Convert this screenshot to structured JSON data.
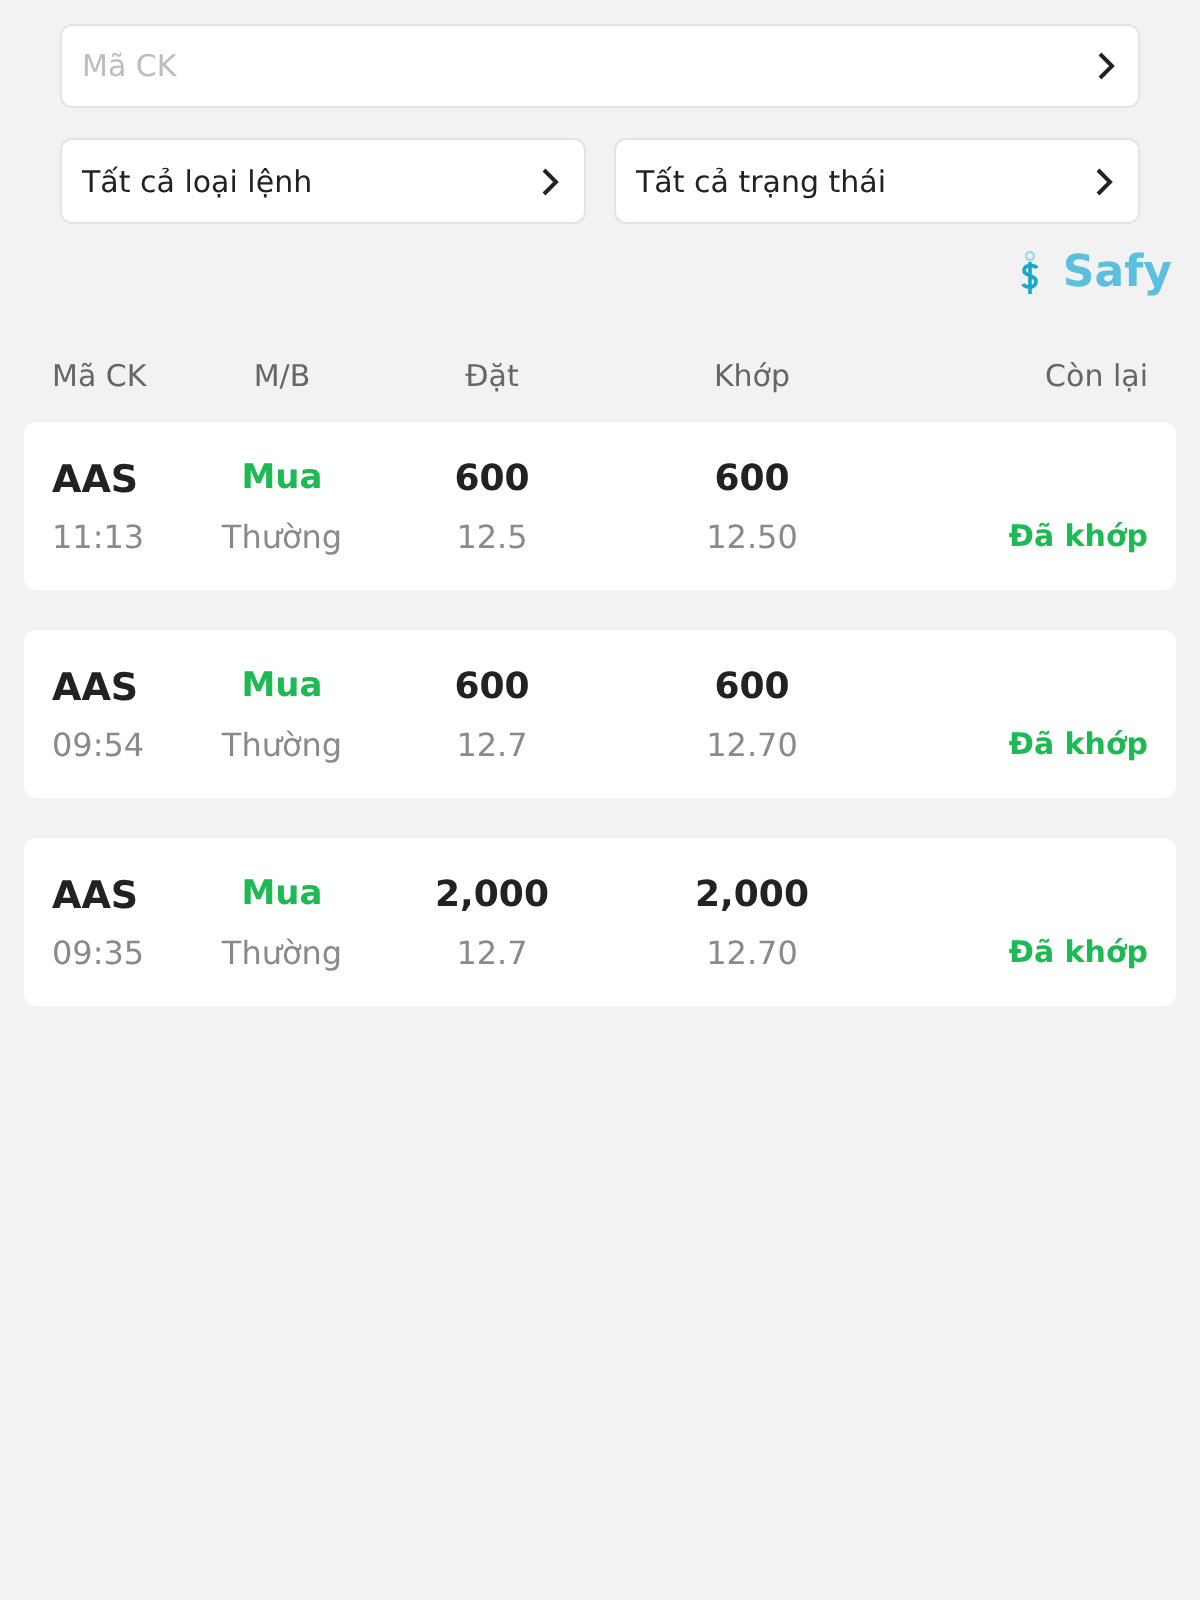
{
  "search": {
    "placeholder": "Mã CK"
  },
  "filters": [
    {
      "label": "Tất cả loại lệnh"
    },
    {
      "label": "Tất cả trạng thái"
    }
  ],
  "brand": {
    "name": "Safy"
  },
  "table": {
    "columns": [
      "Mã CK",
      "M/B",
      "Đặt",
      "Khớp",
      "Còn lại"
    ],
    "rows": [
      {
        "symbol": "AAS",
        "time": "11:13",
        "side": {
          "text": "Mua",
          "kind": "buy"
        },
        "order_type": "Thường",
        "order_qty": "600",
        "order_price": "12.5",
        "match_qty": "600",
        "match_price": "12.50",
        "status": {
          "text": "Đã khớp",
          "kind": "matched"
        }
      },
      {
        "symbol": "AAS",
        "time": "09:54",
        "side": {
          "text": "Mua",
          "kind": "buy"
        },
        "order_type": "Thường",
        "order_qty": "600",
        "order_price": "12.7",
        "match_qty": "600",
        "match_price": "12.70",
        "status": {
          "text": "Đã khớp",
          "kind": "matched"
        }
      },
      {
        "symbol": "AAS",
        "time": "09:35",
        "side": {
          "text": "Mua",
          "kind": "buy"
        },
        "order_type": "Thường",
        "order_qty": "2,000",
        "order_price": "12.7",
        "match_qty": "2,000",
        "match_price": "12.70",
        "status": {
          "text": "Đã khớp",
          "kind": "matched"
        }
      }
    ]
  }
}
